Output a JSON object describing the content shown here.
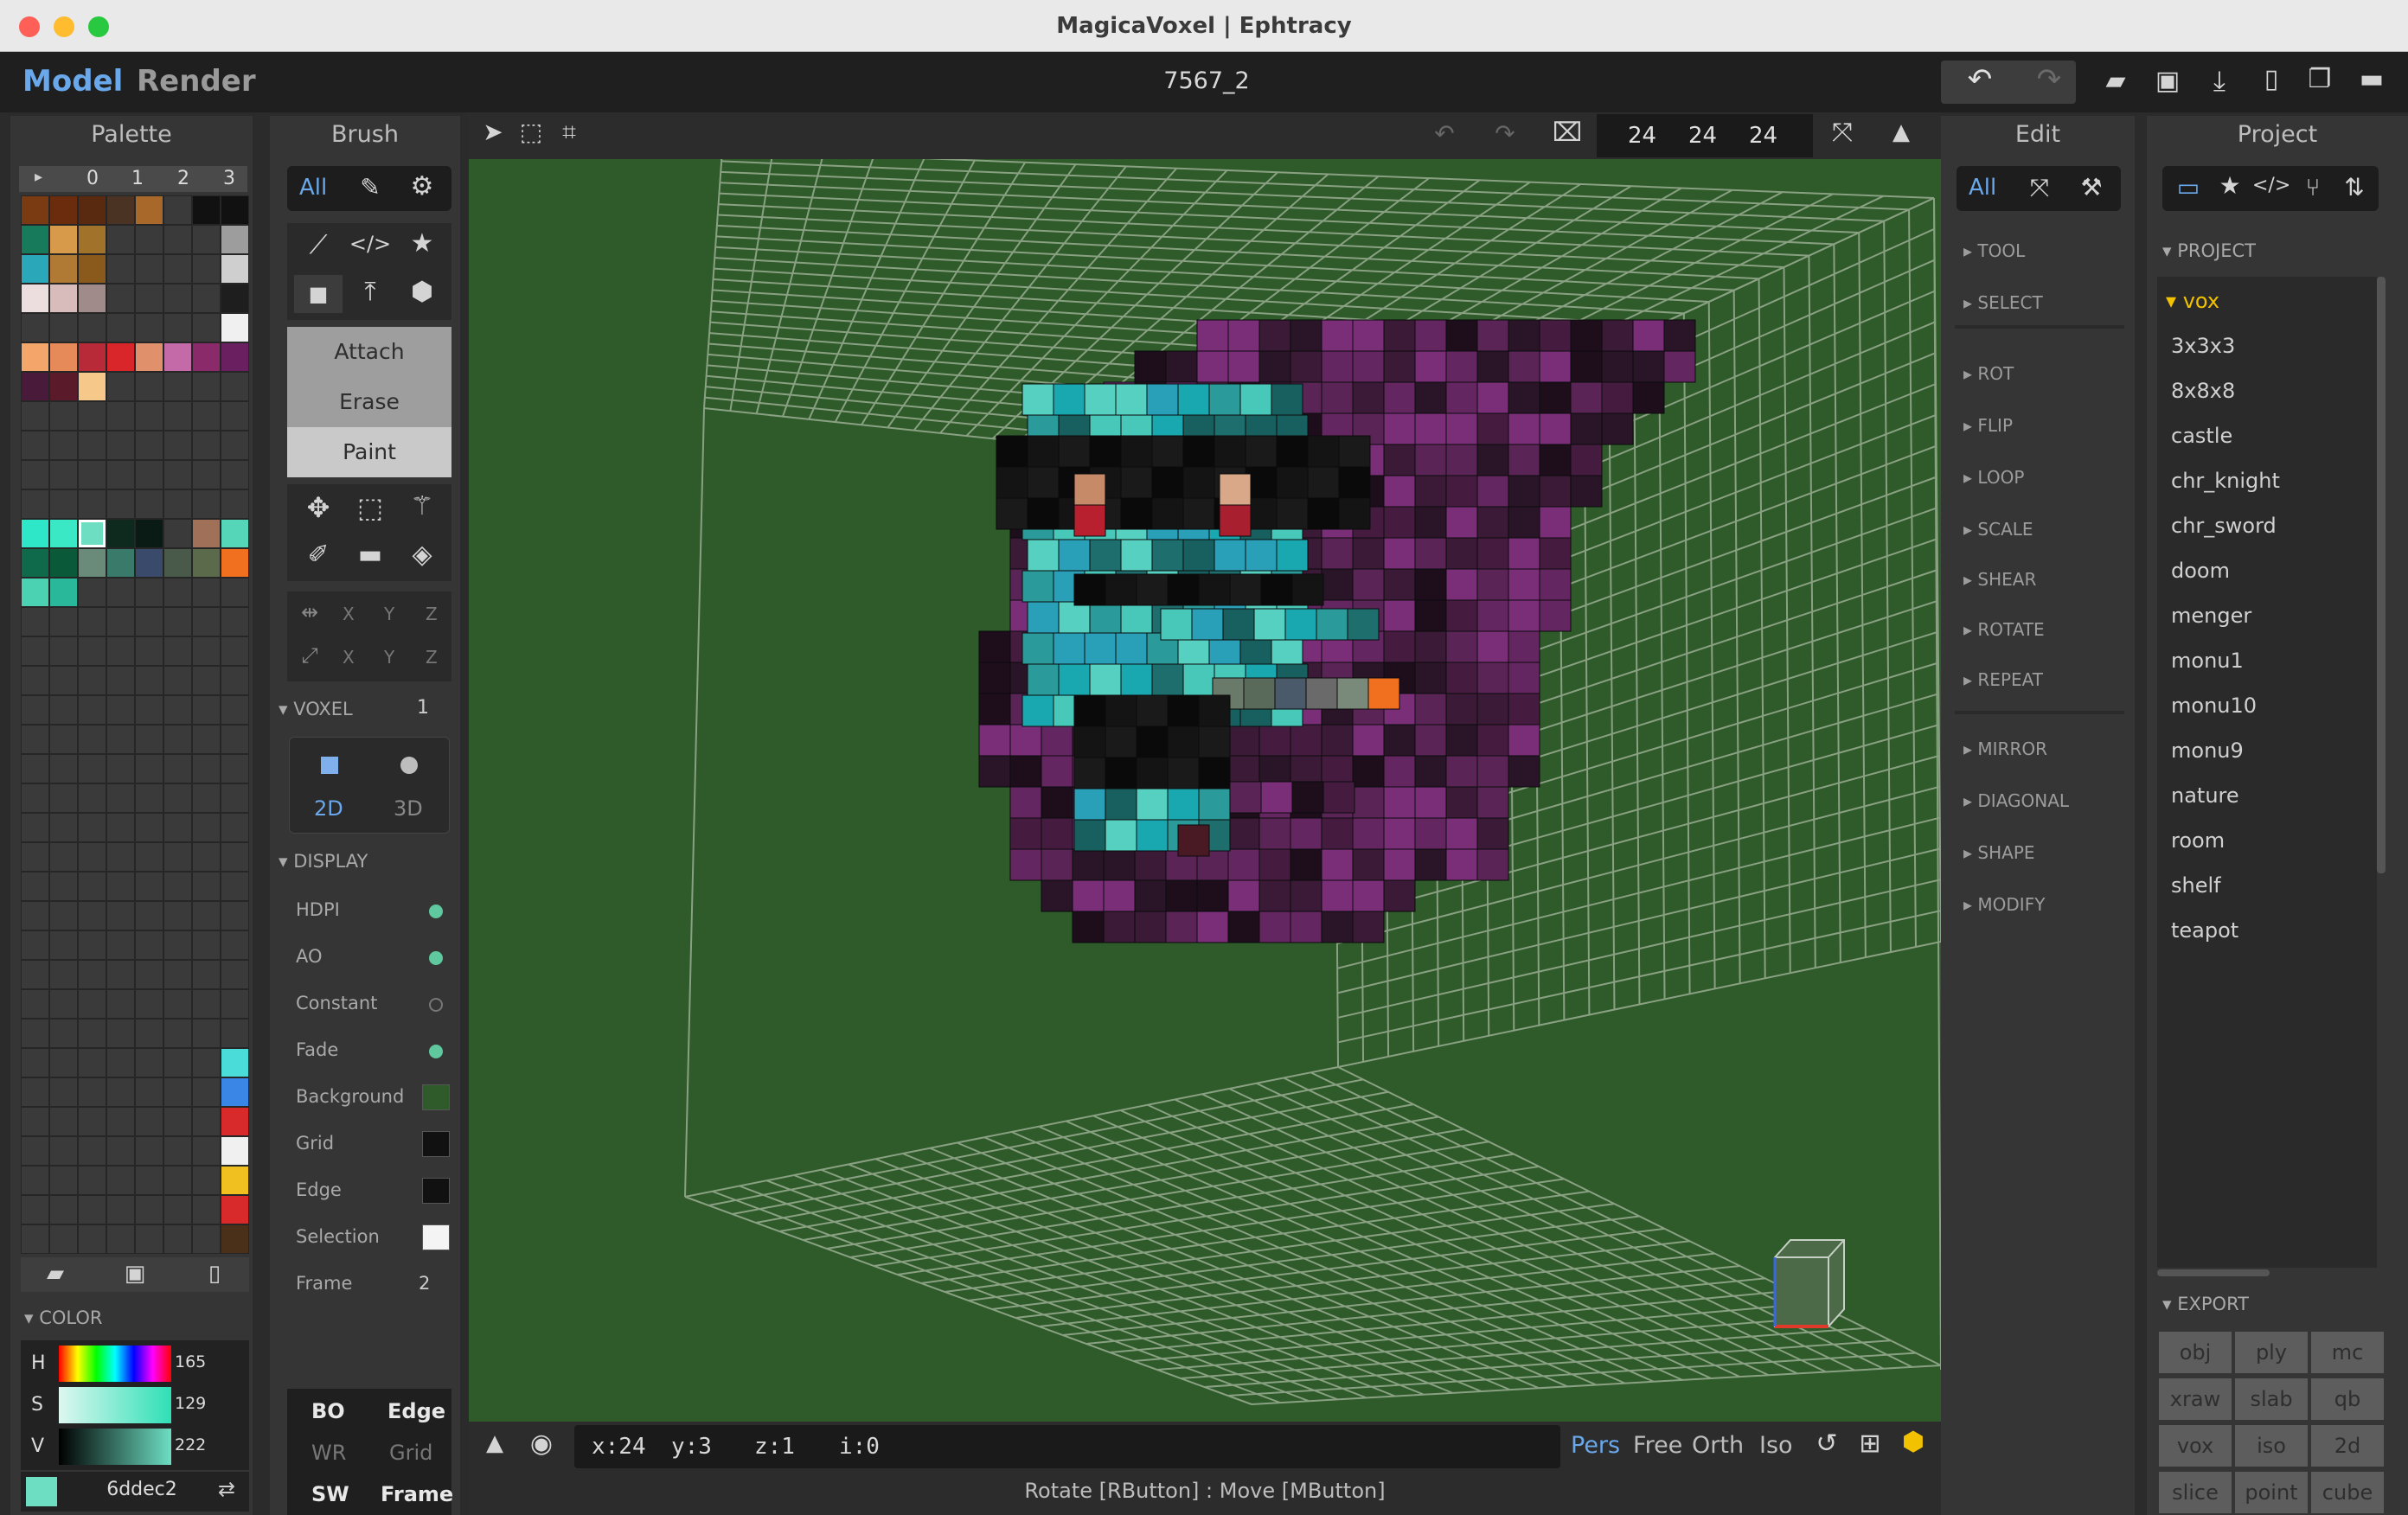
{
  "window": {
    "title": "MagicaVoxel | Ephtracy"
  },
  "header": {
    "mode_model": "Model",
    "mode_render": "Render",
    "file_name": "7567_2"
  },
  "palette": {
    "title": "Palette",
    "pages": [
      "0",
      "1",
      "2",
      "3"
    ],
    "color_section": "COLOR",
    "h_label": "H",
    "s_label": "S",
    "v_label": "V",
    "h_value": "165",
    "s_value": "129",
    "v_value": "222",
    "hex": "6ddec2"
  },
  "brush": {
    "title": "Brush",
    "tab_all": "All",
    "attach": "Attach",
    "erase": "Erase",
    "paint": "Paint",
    "axes": [
      "X",
      "Y",
      "Z"
    ],
    "voxel_section": "VOXEL",
    "voxel_count": "1",
    "mode_2d": "2D",
    "mode_3d": "3D",
    "display_section": "DISPLAY",
    "display": [
      {
        "label": "HDPI",
        "type": "dot",
        "on": true
      },
      {
        "label": "AO",
        "type": "dot",
        "on": true
      },
      {
        "label": "Constant",
        "type": "dot",
        "on": false
      },
      {
        "label": "Fade",
        "type": "dot",
        "on": true
      },
      {
        "label": "Background",
        "type": "swatch",
        "color": "#2f5a2a"
      },
      {
        "label": "Grid",
        "type": "swatch",
        "color": "#111111"
      },
      {
        "label": "Edge",
        "type": "swatch",
        "color": "#111111"
      },
      {
        "label": "Selection",
        "type": "swatch",
        "color": "#f4f4f4"
      },
      {
        "label": "Frame",
        "type": "num",
        "value": "2"
      }
    ],
    "bottom": {
      "bo": "BO",
      "edge": "Edge",
      "wr": "WR",
      "grid": "Grid",
      "sw": "SW",
      "frame": "Frame"
    }
  },
  "viewport": {
    "size": [
      "24",
      "24",
      "24"
    ],
    "coords": {
      "x": "x:24",
      "y": "y:3",
      "z": "z:1",
      "i": "i:0"
    },
    "views": [
      "Pers",
      "Free",
      "Orth",
      "Iso"
    ],
    "status": "Rotate [RButton] : Move [MButton]",
    "background": "#2f5a2a"
  },
  "edit": {
    "title": "Edit",
    "tab_all": "All",
    "sections": [
      "TOOL",
      "SELECT",
      "ROT",
      "FLIP",
      "LOOP",
      "SCALE",
      "SHEAR",
      "ROTATE",
      "REPEAT",
      "MIRROR",
      "DIAGONAL",
      "SHAPE",
      "MODIFY"
    ]
  },
  "project": {
    "title": "Project",
    "section": "PROJECT",
    "folder": "vox",
    "items": [
      "3x3x3",
      "8x8x8",
      "castle",
      "chr_knight",
      "chr_sword",
      "doom",
      "menger",
      "monu1",
      "monu10",
      "monu9",
      "nature",
      "room",
      "shelf",
      "teapot"
    ],
    "export_section": "EXPORT",
    "export": [
      "obj",
      "ply",
      "mc",
      "xraw",
      "slab",
      "qb",
      "vox",
      "iso",
      "2d",
      "slice",
      "point",
      "cube"
    ]
  },
  "colors": {
    "accent": "#6aa8ec",
    "selected": "#6ddec2",
    "folder": "#f2c200"
  }
}
